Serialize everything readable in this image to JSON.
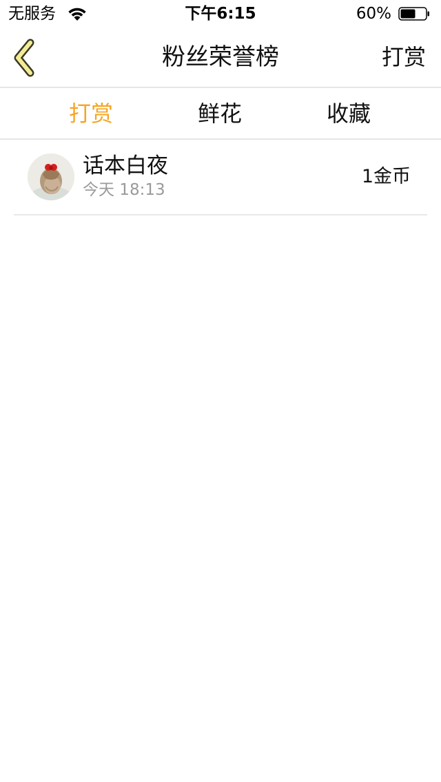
{
  "status_bar": {
    "carrier": "无服务",
    "time": "下午6:15",
    "battery_percent": "60%",
    "battery_level": 0.6,
    "wifi_icon": "wifi-icon",
    "battery_icon": "battery-icon"
  },
  "nav": {
    "back_icon": "chevron-left-icon",
    "title": "粉丝荣誉榜",
    "action_label": "打赏"
  },
  "colors": {
    "accent": "#F5A623",
    "back_icon_fill": "#F3EC97",
    "divider": "#E6E6E6",
    "secondary_text": "#9A9A9A"
  },
  "tabs": [
    {
      "label": "打赏",
      "active": true
    },
    {
      "label": "鲜花",
      "active": false
    },
    {
      "label": "收藏",
      "active": false
    }
  ],
  "list": [
    {
      "avatar_icon": "avatar",
      "name": "话本白夜",
      "time": "今天 18:13",
      "amount": "1金币"
    }
  ]
}
